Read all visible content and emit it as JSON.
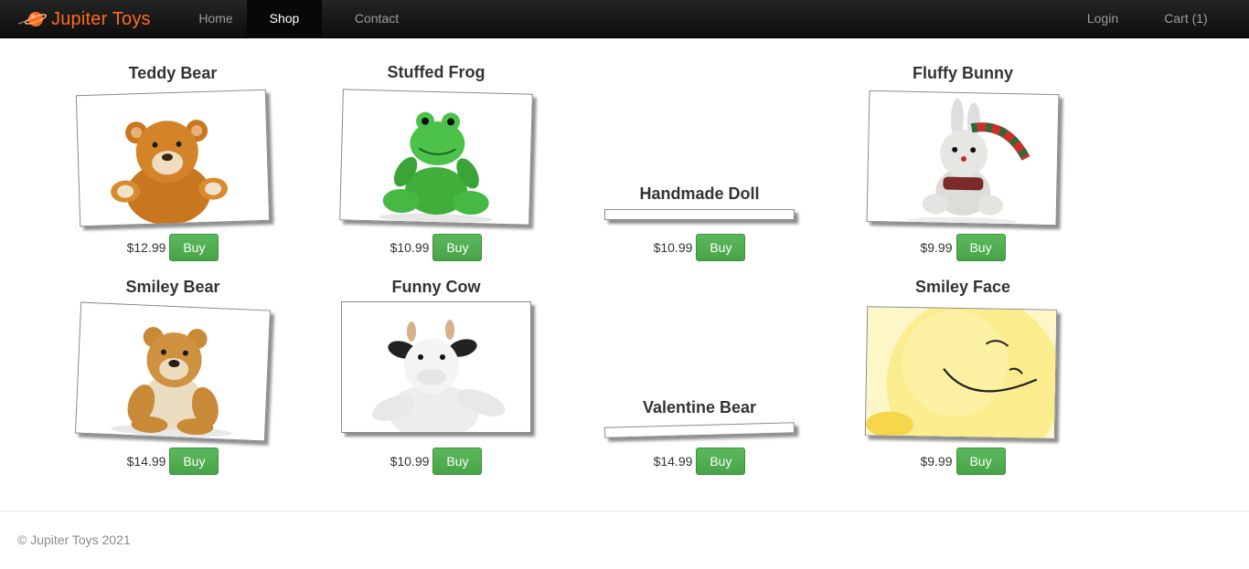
{
  "navbar": {
    "brand": "Jupiter Toys",
    "links": [
      {
        "label": "Home"
      },
      {
        "label": "Shop"
      },
      {
        "label": "Contact"
      }
    ],
    "login": "Login",
    "cart": "Cart (1)"
  },
  "products": [
    {
      "name": "Teddy Bear",
      "price": "$12.99",
      "buy": "Buy",
      "image": "teddy-bear-image"
    },
    {
      "name": "Stuffed Frog",
      "price": "$10.99",
      "buy": "Buy",
      "image": "stuffed-frog-image"
    },
    {
      "name": "Handmade Doll",
      "price": "$10.99",
      "buy": "Buy",
      "image": ""
    },
    {
      "name": "Fluffy Bunny",
      "price": "$9.99",
      "buy": "Buy",
      "image": "fluffy-bunny-image"
    },
    {
      "name": "Smiley Bear",
      "price": "$14.99",
      "buy": "Buy",
      "image": "smiley-bear-image"
    },
    {
      "name": "Funny Cow",
      "price": "$10.99",
      "buy": "Buy",
      "image": "funny-cow-image"
    },
    {
      "name": "Valentine Bear",
      "price": "$14.99",
      "buy": "Buy",
      "image": ""
    },
    {
      "name": "Smiley Face",
      "price": "$9.99",
      "buy": "Buy",
      "image": "smiley-face-image"
    }
  ],
  "footer": {
    "copyright": "© Jupiter Toys 2021"
  },
  "colors": {
    "brand": "#ff6a1f",
    "navbar": "#1b1b1b",
    "buy_button": "#5cb85c"
  }
}
